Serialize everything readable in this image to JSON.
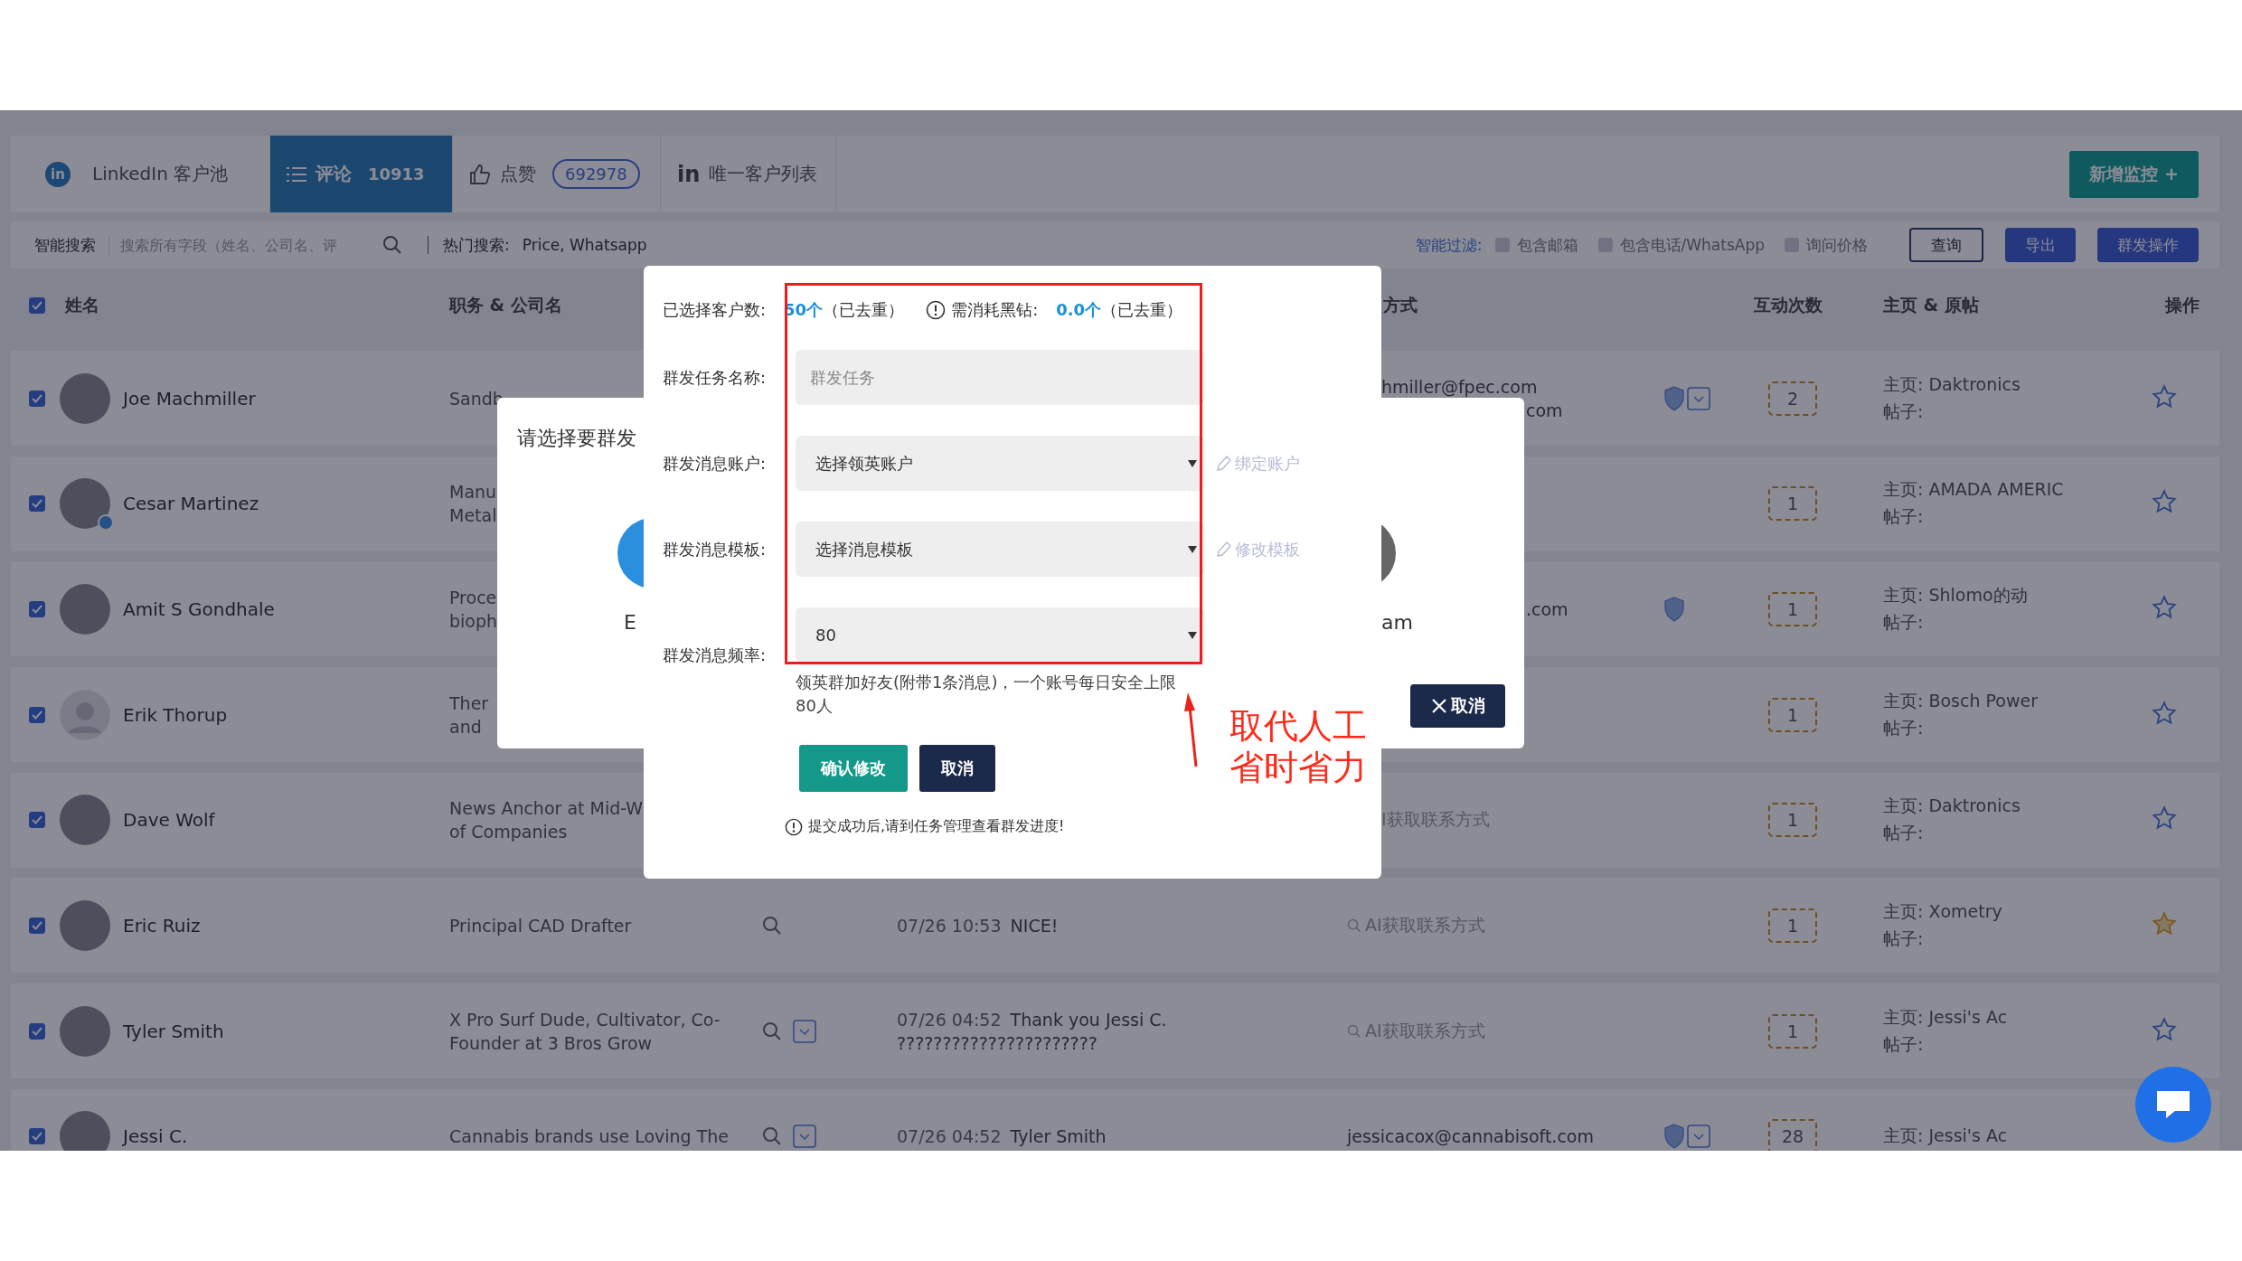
{
  "tabs": [
    {
      "kind": "linkedin",
      "icon_text": "in",
      "label": "LinkedIn 客户池",
      "selected": false
    },
    {
      "kind": "list",
      "label": "评论",
      "count": "10913",
      "selected": true
    },
    {
      "kind": "thumb",
      "label": "点赞",
      "count": "692978",
      "selected": false
    },
    {
      "kind": "linkedin_outline",
      "icon_text": "in",
      "label": "唯一客户列表",
      "selected": false
    }
  ],
  "add_button": "新增监控 +",
  "search": {
    "label": "智能搜索",
    "placeholder": "搜索所有字段（姓名、公司名、评",
    "hot_label": "热门搜索:",
    "hot_terms": "Price, Whatsapp"
  },
  "filter": {
    "label": "智能过滤:",
    "options": [
      {
        "label": "包含邮箱",
        "checked": false
      },
      {
        "label": "包含电话/WhatsApp",
        "checked": false
      },
      {
        "label": "询问价格",
        "checked": false
      }
    ]
  },
  "actions": [
    {
      "label": "查询",
      "kind": "outline"
    },
    {
      "label": "导出",
      "kind": "primary"
    },
    {
      "label": "群发操作",
      "kind": "primary"
    }
  ],
  "table": {
    "all_checked": true,
    "columns": [
      {
        "kind": "name",
        "label": "姓名"
      },
      {
        "kind": "title",
        "label": "职务 & 公司名"
      },
      {
        "kind": "contact",
        "label": "方式"
      },
      {
        "kind": "count",
        "label": "互动次数"
      },
      {
        "kind": "homepage",
        "label": "主页 & 原帖"
      },
      {
        "kind": "action",
        "label": "操作"
      }
    ],
    "rows": [
      {
        "name": "Joe Machmiller",
        "checked": true,
        "photo": true,
        "badge": false,
        "title": [
          "Sandb"
        ],
        "search": false,
        "dropdown": false,
        "contact": {
          "kind": "text",
          "lines": [
            "hmiller@fpec.com",
            "com"
          ]
        },
        "shield": true,
        "contact_dropdown": true,
        "count": "2",
        "homepage": "主页: Daktronics",
        "post": "帖子:",
        "starred": false
      },
      {
        "name": "Cesar Martinez",
        "checked": true,
        "photo": true,
        "badge": true,
        "title": [
          "Manu",
          "Metal"
        ],
        "search": false,
        "dropdown": false,
        "shield": false,
        "contact_dropdown": false,
        "count": "1",
        "homepage": "主页: AMADA AMERIC",
        "post": "帖子:",
        "starred": false
      },
      {
        "name": "Amit S Gondhale",
        "checked": true,
        "photo": true,
        "badge": false,
        "title": [
          "Proce",
          "bioph"
        ],
        "search": false,
        "dropdown": false,
        "contact": {
          "kind": "text",
          "lines": [
            ".com"
          ]
        },
        "shield": true,
        "contact_dropdown": false,
        "count": "1",
        "homepage": "主页: Shlomo的动",
        "post": "帖子:",
        "starred": false
      },
      {
        "name": "Erik Thorup",
        "checked": true,
        "photo": false,
        "badge": false,
        "title": [
          "Ther",
          "and"
        ],
        "search": false,
        "dropdown": false,
        "shield": false,
        "contact_dropdown": false,
        "count": "1",
        "homepage": "主页: Bosch Power",
        "post": "帖子:",
        "starred": false
      },
      {
        "name": "Dave Wolf",
        "checked": true,
        "photo": true,
        "badge": false,
        "title": [
          "News Anchor at Mid-W",
          "of Companies"
        ],
        "search": false,
        "dropdown": false,
        "contact": {
          "kind": "lookup",
          "icon": false,
          "lines": [
            "I获取联系方式"
          ]
        },
        "shield": false,
        "contact_dropdown": false,
        "count": "1",
        "homepage": "主页: Daktronics",
        "post": "帖子:",
        "starred": false
      },
      {
        "name": "Eric Ruiz",
        "checked": true,
        "photo": true,
        "badge": false,
        "title": [
          "Principal CAD Drafter"
        ],
        "search": true,
        "dropdown": false,
        "comment": {
          "time": "07/26 10:53",
          "text": "NICE!"
        },
        "contact": {
          "kind": "lookup",
          "icon": true,
          "lines": [
            "AI获取联系方式"
          ]
        },
        "shield": false,
        "contact_dropdown": false,
        "count": "1",
        "homepage": "主页: Xometry",
        "post": "帖子:",
        "starred": true
      },
      {
        "name": "Tyler Smith",
        "checked": true,
        "photo": true,
        "badge": false,
        "title": [
          "X Pro Surf Dude, Cultivator, Co-",
          "Founder at 3 Bros Grow"
        ],
        "search": true,
        "dropdown": true,
        "comment": {
          "time": "07/26 04:52",
          "text": "Thank you Jessi C.",
          "extra": "??????????????????????"
        },
        "contact": {
          "kind": "lookup",
          "icon": true,
          "lines": [
            "AI获取联系方式"
          ]
        },
        "shield": false,
        "contact_dropdown": false,
        "count": "1",
        "homepage": "主页: Jessi's Ac",
        "post": "帖子:",
        "starred": false
      },
      {
        "name": "Jessi C.",
        "checked": true,
        "photo": true,
        "badge": false,
        "title": [
          "Cannabis brands use Loving The"
        ],
        "search": true,
        "dropdown": true,
        "comment": {
          "time": "07/26 04:52",
          "text": "Tyler Smith"
        },
        "contact": {
          "kind": "text",
          "lines": [
            "jessicacox@cannabisoft.com"
          ]
        },
        "shield": true,
        "contact_dropdown": true,
        "count": "28",
        "homepage": "主页: Jessi's Ac"
      }
    ]
  },
  "send_panel": {
    "title": "请选择要群发",
    "left_option": "E",
    "right_option": "am",
    "cancel": "取消"
  },
  "modal": {
    "summary": {
      "label": "已选择客户数:",
      "count": "50个",
      "count_note": "（已去重）",
      "cost_label": "需消耗黑钻:",
      "cost": "0.0个",
      "cost_note": "（已去重）"
    },
    "fields": [
      {
        "kind": "input",
        "label": "群发任务名称:",
        "placeholder": "群发任务"
      },
      {
        "kind": "select",
        "label": "群发消息账户:",
        "value": "选择领英账户",
        "link": "绑定账户"
      },
      {
        "kind": "select",
        "label": "群发消息模板:",
        "value": "选择消息模板",
        "link": "修改模板"
      },
      {
        "kind": "select",
        "label": "群发消息频率:",
        "value": "80",
        "help": "领英群加好友(附带1条消息)，一个账号每日安全上限80人"
      }
    ],
    "buttons": [
      {
        "label": "确认修改",
        "kind": "confirm"
      },
      {
        "label": "取消",
        "kind": "cancel"
      }
    ],
    "note": "提交成功后,请到任务管理查看群发进度!"
  },
  "annotation": {
    "lines": [
      "取代人工",
      "省时省力"
    ]
  }
}
